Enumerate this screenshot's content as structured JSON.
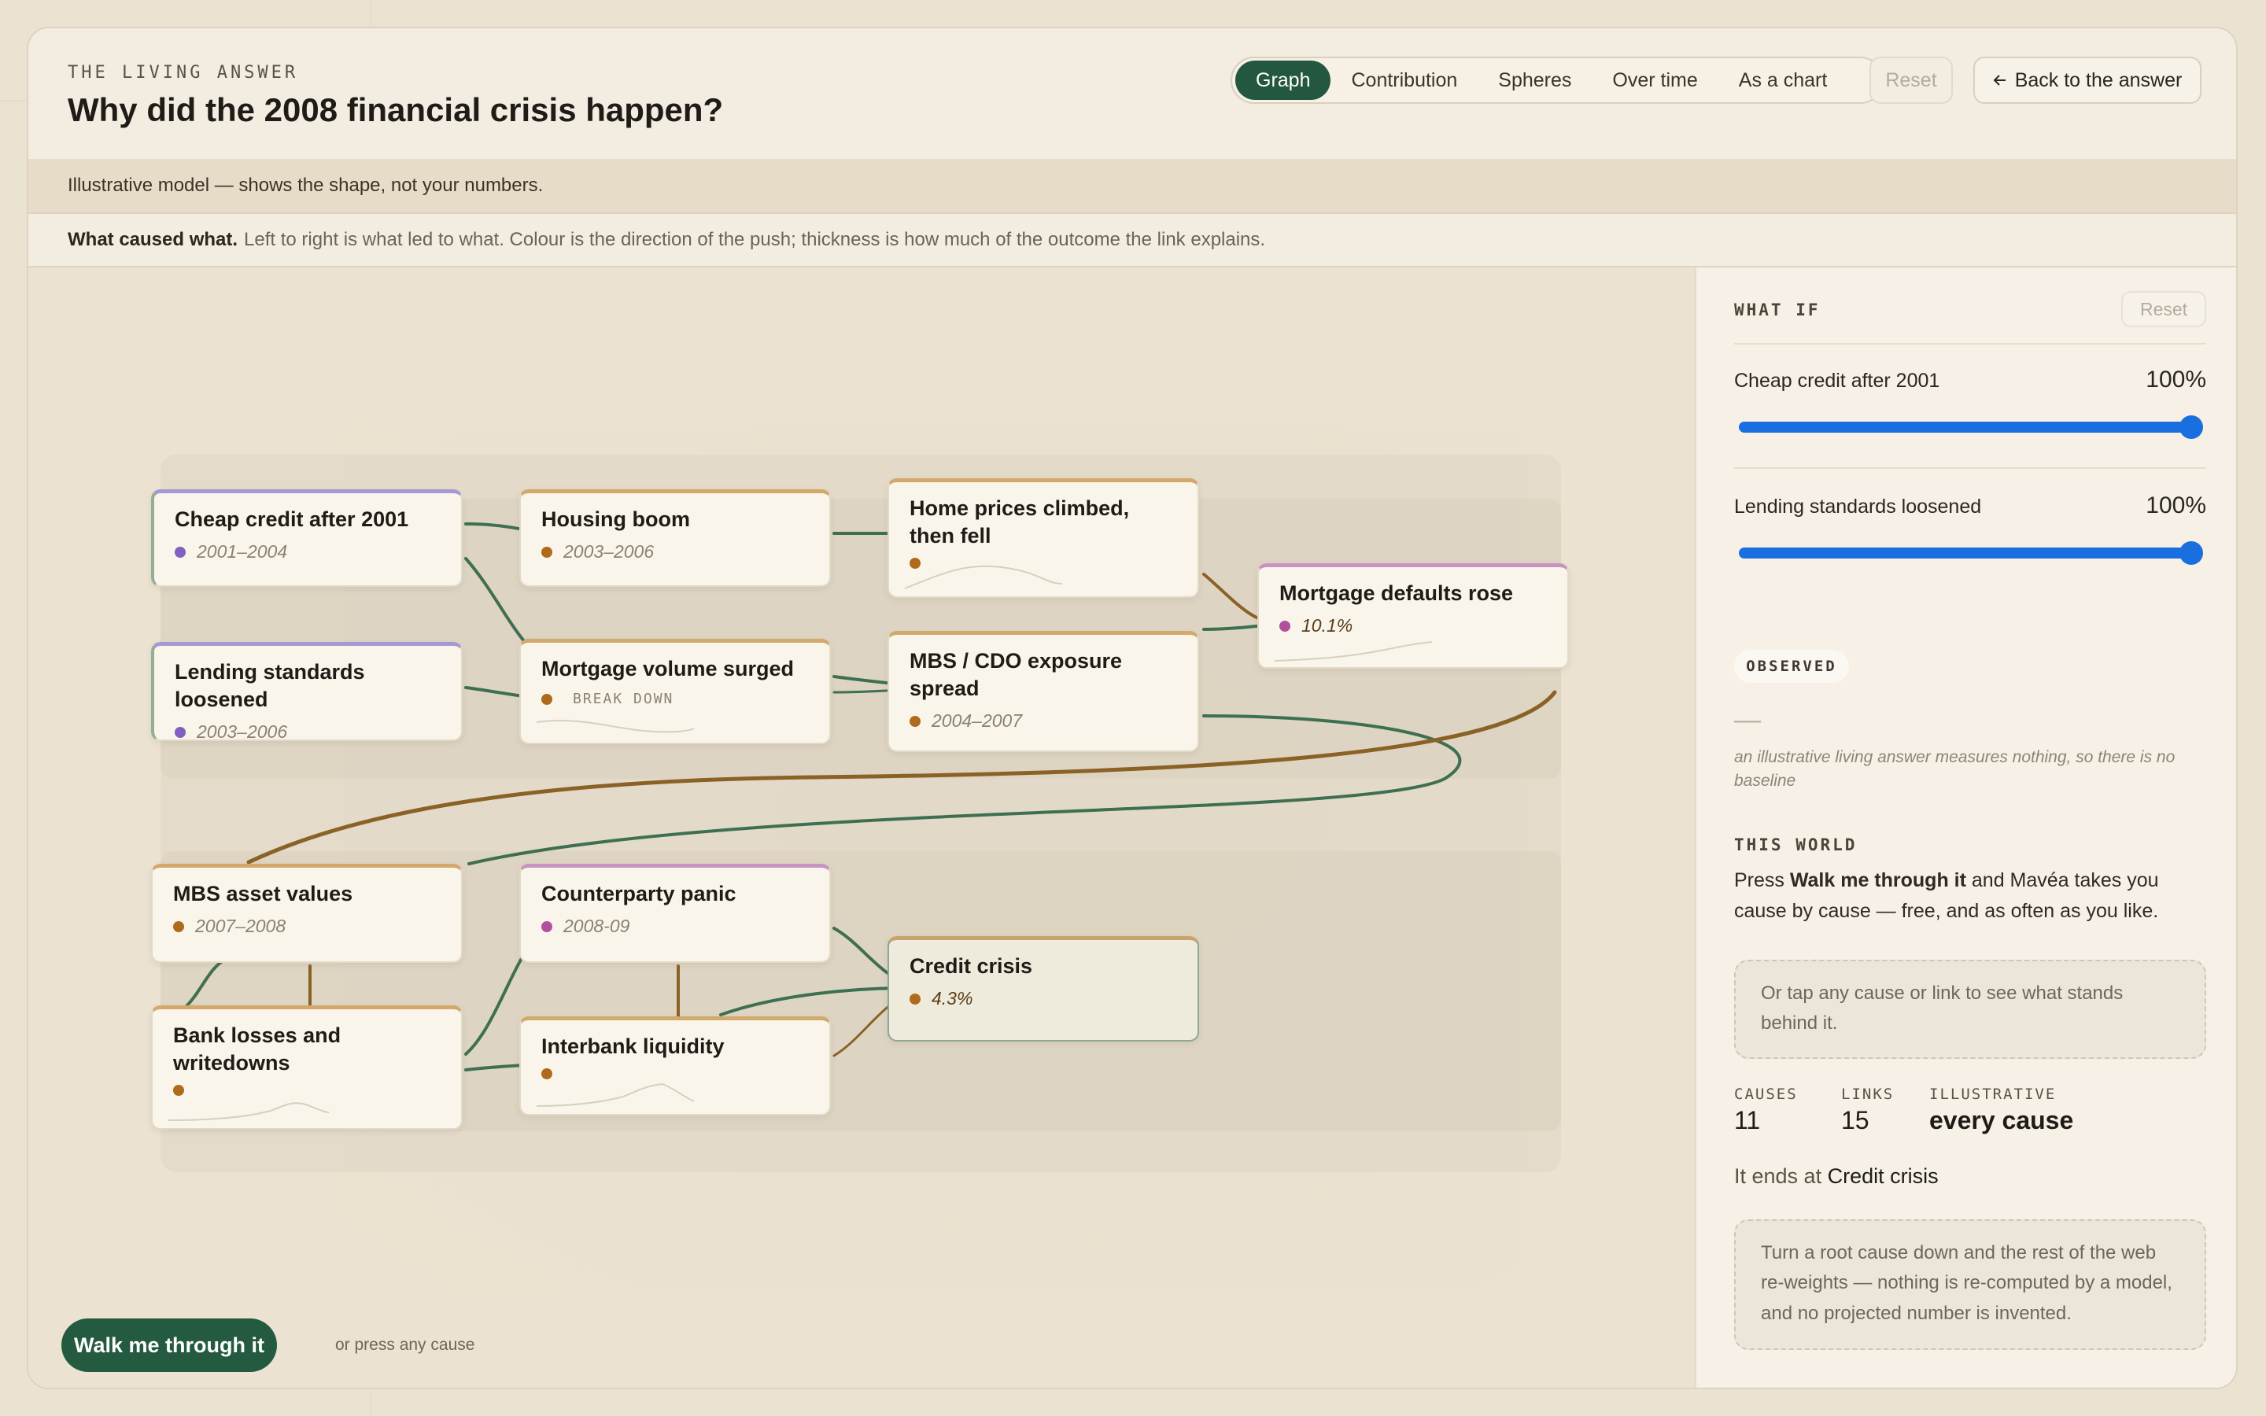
{
  "header": {
    "eyebrow": "THE LIVING ANSWER",
    "title": "Why did the 2008 financial crisis happen?",
    "tabs": [
      {
        "label": "Graph",
        "active": true
      },
      {
        "label": "Contribution",
        "active": false
      },
      {
        "label": "Spheres",
        "active": false
      },
      {
        "label": "Over time",
        "active": false
      },
      {
        "label": "As a chart",
        "active": false
      }
    ],
    "reset_label": "Reset",
    "back_label": "Back to the answer",
    "back_icon": "arrow-left-icon"
  },
  "notice": "Illustrative model — shows the shape, not your numbers.",
  "legend": {
    "lead": "What caused what.",
    "text": "Left to right is what led to what. Colour is the direction of the push; thickness is how much of the outcome the link explains."
  },
  "graph": {
    "colors": {
      "green_link": "#3f6f52",
      "brown_link": "#8a6225",
      "accent": "#245a40"
    },
    "nodes": [
      {
        "id": "cheap",
        "label": "Cheap credit after 2001",
        "meta": "2001–2004",
        "dot": "purple"
      },
      {
        "id": "lending",
        "label": "Lending standards loosened",
        "meta": "2003–2006",
        "dot": "purple"
      },
      {
        "id": "housing",
        "label": "Housing boom",
        "meta": "2003–2006",
        "dot": "brown"
      },
      {
        "id": "mortvol",
        "label": "Mortgage volume surged",
        "meta": "BREAK DOWN",
        "dot": "brown"
      },
      {
        "id": "homeprices",
        "label": "Home prices climbed, then fell",
        "meta": "",
        "dot": "brown"
      },
      {
        "id": "mbscdo",
        "label": "MBS / CDO exposure spread",
        "meta": "2004–2007",
        "dot": "brown"
      },
      {
        "id": "defaults",
        "label": "Mortgage defaults rose",
        "meta": "10.1%",
        "dot": "pink"
      },
      {
        "id": "mbsasset",
        "label": "MBS asset values",
        "meta": "2007–2008",
        "dot": "brown"
      },
      {
        "id": "counterparty",
        "label": "Counterparty panic",
        "meta": "2008-09",
        "dot": "pink"
      },
      {
        "id": "credit",
        "label": "Credit crisis",
        "meta": "4.3%",
        "dot": "brown"
      },
      {
        "id": "banklosses",
        "label": "Bank losses and writedowns",
        "meta": "",
        "dot": "brown"
      },
      {
        "id": "interbank",
        "label": "Interbank liquidity",
        "meta": "",
        "dot": "brown"
      }
    ]
  },
  "walk": {
    "button": "Walk me through it",
    "hint": "or press any cause"
  },
  "side": {
    "whatif_title": "WHAT IF",
    "reset_label": "Reset",
    "sliders": [
      {
        "label": "Cheap credit after 2001",
        "value_text": "100%",
        "value": 1.0
      },
      {
        "label": "Lending standards loosened",
        "value_text": "100%",
        "value": 1.0
      }
    ],
    "observed_badge": "OBSERVED",
    "observed_value": "—",
    "observed_note": "an illustrative living answer measures nothing, so there is no baseline",
    "world_title": "THIS WORLD",
    "world_pre": "Press ",
    "world_bold": "Walk me through it",
    "world_post": " and Mavéa takes you cause by cause — free, and as often as you like.",
    "tap_hint": "Or tap any cause or link to see what stands behind it.",
    "stats": [
      {
        "label": "CAUSES",
        "value": "11"
      },
      {
        "label": "LINKS",
        "value": "15"
      },
      {
        "label": "ILLUSTRATIVE",
        "value": "every cause"
      }
    ],
    "ends_pre": "It ends at ",
    "ends_at": "Credit crisis",
    "footnote": "Turn a root cause down and the rest of the web re-weights — nothing is re-computed by a model, and no projected number is invented."
  }
}
